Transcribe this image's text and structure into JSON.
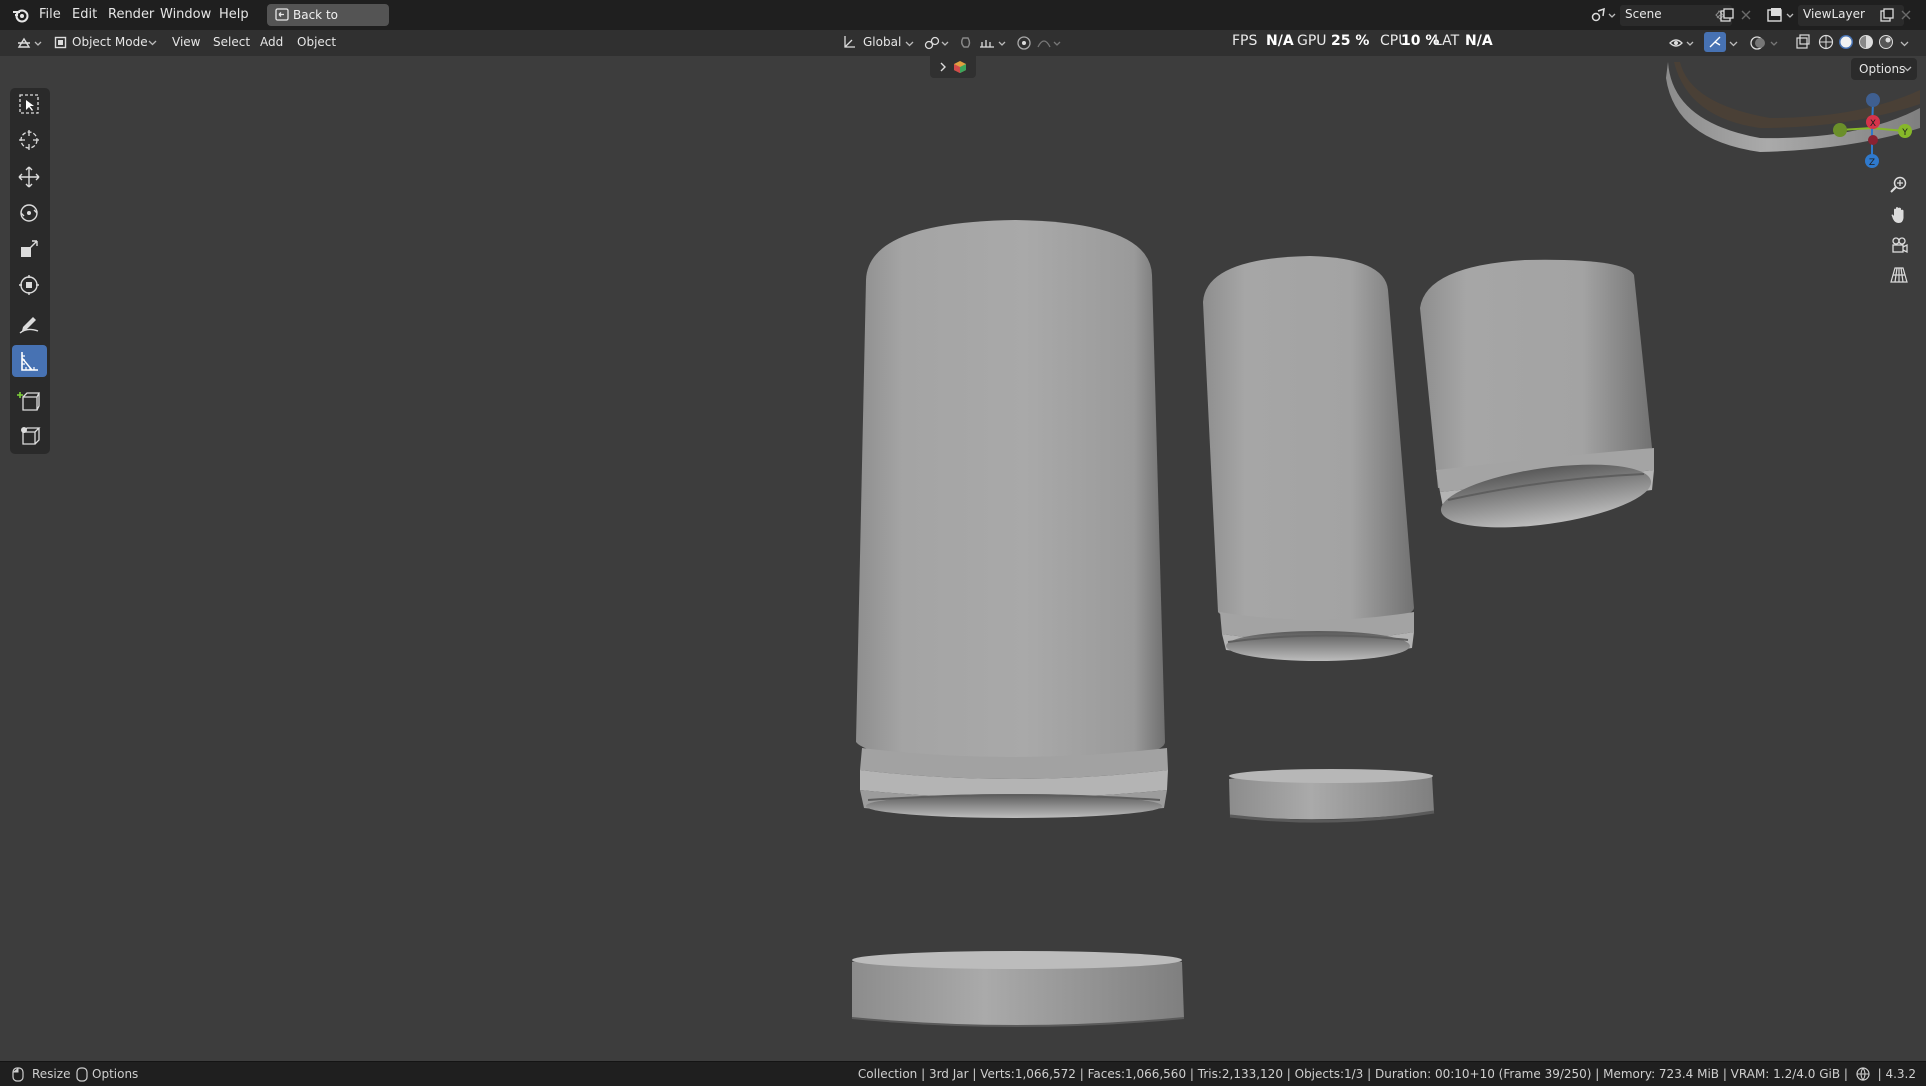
{
  "topbar": {
    "menu": [
      "File",
      "Edit",
      "Render",
      "Window",
      "Help"
    ],
    "back_button": "Back to Previous",
    "scene": "Scene",
    "view_layer": "ViewLayer"
  },
  "header": {
    "mode": "Object Mode",
    "menu": [
      "View",
      "Select",
      "Add",
      "Object"
    ],
    "orientation": "Global",
    "options": "Options"
  },
  "stats": {
    "fps_label": "FPS",
    "fps_value": "N/A",
    "gpu_label": "GPU",
    "gpu_value": "25 %",
    "cpu_label": "CPU",
    "cpu_value": "10 %",
    "lat_label": "LAT",
    "lat_value": "N/A"
  },
  "gizmo": {
    "x": "X",
    "y": "Y",
    "z": "Z"
  },
  "statusbar": {
    "left_action": "Resize",
    "left_options": "Options",
    "info": "Collection | 3rd Jar | Verts:1,066,572 | Faces:1,066,560 | Tris:2,133,120 | Objects:1/3 | Duration: 00:10+10 (Frame 39/250) | Memory: 723.4 MiB | VRAM: 1.2/4.0 GiB |",
    "version": "4.3.2"
  },
  "toolbar_icons": [
    "select-box-icon",
    "cursor-icon",
    "move-icon",
    "rotate-icon",
    "scale-icon",
    "transform-icon",
    "annotate-icon",
    "measure-icon",
    "add-cube-icon",
    "primitive-icon"
  ],
  "colors": {
    "viewport_bg": "#3d3d3d",
    "active_tool": "#4772b3",
    "axis_x": "#d6334a",
    "axis_y": "#86b829",
    "axis_z": "#2f79cc"
  }
}
